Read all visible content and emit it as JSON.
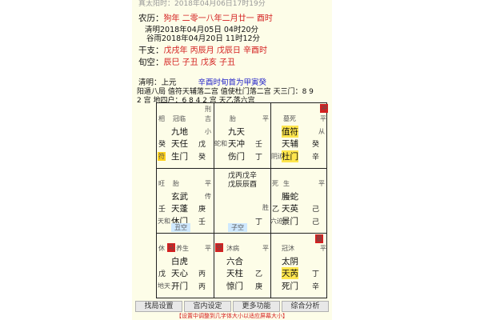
{
  "header": {
    "top_text": "真太阳时：2018年04月06日17时19分",
    "nongli_label": "农历：",
    "nongli_value": "狗年 二零一八年二月廿一 酉时",
    "qingming": "清明2018年04月05日 04时20分",
    "guyu": "谷雨2018年04月20日 11时12分",
    "ganzhi_label": "干支：",
    "ganzhi_value": "戊戌年 丙辰月 戊辰日 辛酉时",
    "xunkong_label": "旬空：",
    "xunkong_value": "辰巳   子丑   戊亥   子丑"
  },
  "info": {
    "line1_a": "清明：上元",
    "line1_b": "辛酉时旬首为甲寅癸",
    "line2": "阳遁八局  值符天辅落二宫  值使杜门落二宫 天三门：8 9",
    "line3": "2 宫  地四户：6 8 4 2 宫  天乙落六宫"
  },
  "palaces": [
    {
      "ltop": "相",
      "top1": "冠临",
      "rtop": "刑",
      "r2": "吉",
      "god": "九地",
      "gsub": "小",
      "star": "天任",
      "stem_r": "戊",
      "stem_l": "癸",
      "door_l": "符",
      "door": "生门",
      "door_stem": "癸"
    },
    {
      "ltop": "",
      "top1": "胎",
      "rtop": "平",
      "r2": "",
      "god": "九天",
      "gsub": "",
      "star": "天冲",
      "stem_r": "壬",
      "stem_l": "蛇和",
      "door_l": "",
      "door": "伤门",
      "door_stem": "丁"
    },
    {
      "ltop": "",
      "top1": "墓死",
      "rtop": "冲",
      "r2": "平",
      "god": "值符",
      "gsub": "从",
      "star": "天辅",
      "stem_r": "癸",
      "stem_l": "",
      "door_l": "阴迫",
      "door": "杜门",
      "door_stem": "辛"
    },
    {
      "ltop": "旺",
      "top1": "胎",
      "rtop": "平",
      "r2": "",
      "god": "玄武",
      "gsub": "传",
      "star": "天蓬",
      "stem_r": "庚",
      "stem_l": "壬",
      "door_l": "天和",
      "door": "休门",
      "door_stem": "壬"
    },
    {
      "ltop": "",
      "top1": "戊丙戊辛",
      "rtop": "",
      "r2": "",
      "god": "戊辰辰酉",
      "gsub": "",
      "star": "",
      "stem_r": "",
      "stem_l": "",
      "door_l": "",
      "door": "",
      "door_stem": "丁"
    },
    {
      "ltop": "死",
      "top1": "生",
      "rtop": "平",
      "r2": "",
      "god": "螣蛇",
      "gsub": "",
      "star": "天英",
      "stem_r": "己",
      "stem_l": "乙",
      "door_l": "六迫",
      "door": "景门",
      "door_stem": "己"
    },
    {
      "ltop": "休",
      "top1": "养生",
      "rtop": "平",
      "r2": "",
      "god": "白虎",
      "gsub": "",
      "star": "天心",
      "stem_r": "丙",
      "stem_l": "戊",
      "door_l": "地天",
      "door": "开门",
      "door_stem": "丙"
    },
    {
      "ltop": "",
      "top1": "沐病",
      "rtop": "平",
      "r2": "",
      "god": "六合",
      "gsub": "",
      "star": "天柱",
      "stem_r": "乙",
      "stem_l": "",
      "door_l": "",
      "door": "惊门",
      "door_stem": "庚"
    },
    {
      "ltop": "",
      "top1": "冠沐",
      "rtop": "墓",
      "r2": "平",
      "god": "太阴",
      "gsub": "",
      "star": "天芮",
      "stem_r": "丁",
      "stem_l": "",
      "door_l": "",
      "door": "死门",
      "door_stem": "辛"
    }
  ],
  "kong": [
    "丑空",
    "子空"
  ],
  "buttons": [
    "找局设置",
    "宫内设定",
    "更多功能",
    "综合分析"
  ],
  "footer": "【设置中调整到几字体大小以适应屏幕大小】"
}
